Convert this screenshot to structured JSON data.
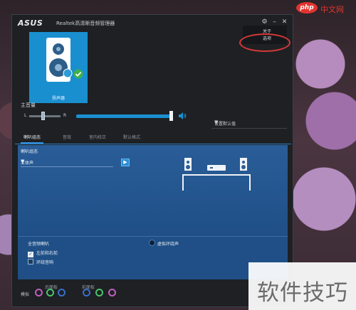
{
  "window": {
    "logo": "ASUS",
    "title": "Realtek高清晰音频管理器",
    "settings_icon": "gear-icon",
    "minimize_icon": "minimize-icon",
    "close_icon": "close-icon"
  },
  "popup_menu": {
    "items": [
      "关于",
      "选项"
    ]
  },
  "device": {
    "label": "扬声器",
    "icon": "speaker-icon",
    "status": "checkmark-icon"
  },
  "volume": {
    "label": "主音量",
    "balance_left": "L",
    "balance_right": "R",
    "level": 0.97,
    "balance": 0.5
  },
  "default_device": {
    "label": "设置默认值",
    "icon": "chevron-down-icon"
  },
  "tabs": [
    {
      "label": "喇叭组态",
      "active": true
    },
    {
      "label": "音效"
    },
    {
      "label": "室内校正"
    },
    {
      "label": "默认格式"
    }
  ],
  "speaker_config": {
    "title": "喇叭组态",
    "selected": "立体声",
    "play_icon": "play-icon"
  },
  "fullrange": {
    "title": "全音频喇叭",
    "options": [
      {
        "label": "左前和右前",
        "checked": true
      },
      {
        "label": "环绕音响",
        "checked": false
      }
    ],
    "virtual_surround": "虚拟环绕声"
  },
  "jacks": {
    "left_label": "模拟",
    "group_a": "后面板",
    "group_b": "前面板"
  },
  "watermark": {
    "text": "软件技巧",
    "site_badge": "php",
    "site_cn": "中文网"
  },
  "colors": {
    "accent": "#1a8fd0",
    "panel": "#2a5d98",
    "annotation": "#d6383a"
  }
}
